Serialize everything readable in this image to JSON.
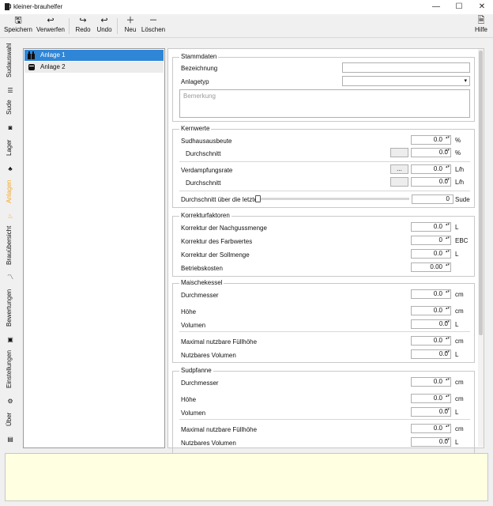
{
  "window": {
    "title": "kleiner-brauhelfer",
    "minimize": "—",
    "maximize": "☐",
    "close": "✕"
  },
  "toolbar": {
    "save": "Speichern",
    "discard": "Verwerfen",
    "redo": "Redo",
    "undo": "Undo",
    "new": "Neu",
    "delete": "Löschen",
    "help": "Hilfe"
  },
  "sidebar": {
    "items": [
      {
        "label": "Sudauswahl",
        "icon": "list-icon"
      },
      {
        "label": "Sude",
        "icon": "camera-icon"
      },
      {
        "label": "Lager",
        "icon": "hops-icon"
      },
      {
        "label": "Anlagen",
        "icon": "brewery-icon"
      },
      {
        "label": "Brauübersicht",
        "icon": "chart-icon"
      },
      {
        "label": "Bewertungen",
        "icon": "rating-icon"
      },
      {
        "label": "Einstellungen",
        "icon": "gear-icon"
      },
      {
        "label": "Über",
        "icon": "info-icon"
      }
    ]
  },
  "accent_color": "#f5a623",
  "list": {
    "items": [
      "Anlage 1",
      "Anlage 2"
    ],
    "selected": 0
  },
  "stammdaten": {
    "title": "Stammdaten",
    "bezeichnung": "Bezeichnung",
    "anlagetyp": "Anlagetyp",
    "bemerkung_placeholder": "Bemerkung"
  },
  "kernwerte": {
    "title": "Kernwerte",
    "sudhausausbeute": "Sudhausausbeute",
    "sha_value": "0.0",
    "sha_unit": "%",
    "durchschnitt": "Durchschnitt",
    "sha_avg": "0.0",
    "sha_avg_unit": "%",
    "verdampfungsrate": "Verdampfungsrate",
    "vr_btn": "...",
    "vr_value": "0.0",
    "vr_unit": "L/h",
    "vr_avg": "0.0",
    "vr_avg_unit": "L/h",
    "letzte": "Durchschnitt über die letzten",
    "sude_value": "0",
    "sude_unit": "Sude"
  },
  "korrektur": {
    "title": "Korrekturfaktoren",
    "nachguss": "Korrektur der Nachgussmenge",
    "nachguss_value": "0.0",
    "nachguss_unit": "L",
    "farb": "Korrektur des Farbwertes",
    "farb_value": "0",
    "farb_unit": "EBC",
    "soll": "Korrektur der Sollmenge",
    "soll_value": "0.0",
    "soll_unit": "L",
    "kosten": "Betriebskosten",
    "kosten_value": "0.00"
  },
  "maische": {
    "title": "Maischekessel",
    "durchmesser": "Durchmesser",
    "d_value": "0.0",
    "d_unit": "cm",
    "hoehe": "Höhe",
    "h_value": "0.0",
    "h_unit": "cm",
    "volumen": "Volumen",
    "v_value": "0.0",
    "v_unit": "L",
    "maxhoehe": "Maximal nutzbare Füllhöhe",
    "mh_value": "0.0",
    "mh_unit": "cm",
    "nutzvol": "Nutzbares Volumen",
    "nv_value": "0.0",
    "nv_unit": "L"
  },
  "sudpfanne": {
    "title": "Sudpfanne",
    "durchmesser": "Durchmesser",
    "d_value": "0.0",
    "d_unit": "cm",
    "hoehe": "Höhe",
    "h_value": "0.0",
    "h_unit": "cm",
    "volumen": "Volumen",
    "v_value": "0.0",
    "v_unit": "L",
    "maxhoehe": "Maximal nutzbare Füllhöhe",
    "mh_value": "0.0",
    "mh_unit": "cm",
    "nutzvol": "Nutzbares Volumen",
    "nv_value": "0.0",
    "nv_unit": "L"
  }
}
